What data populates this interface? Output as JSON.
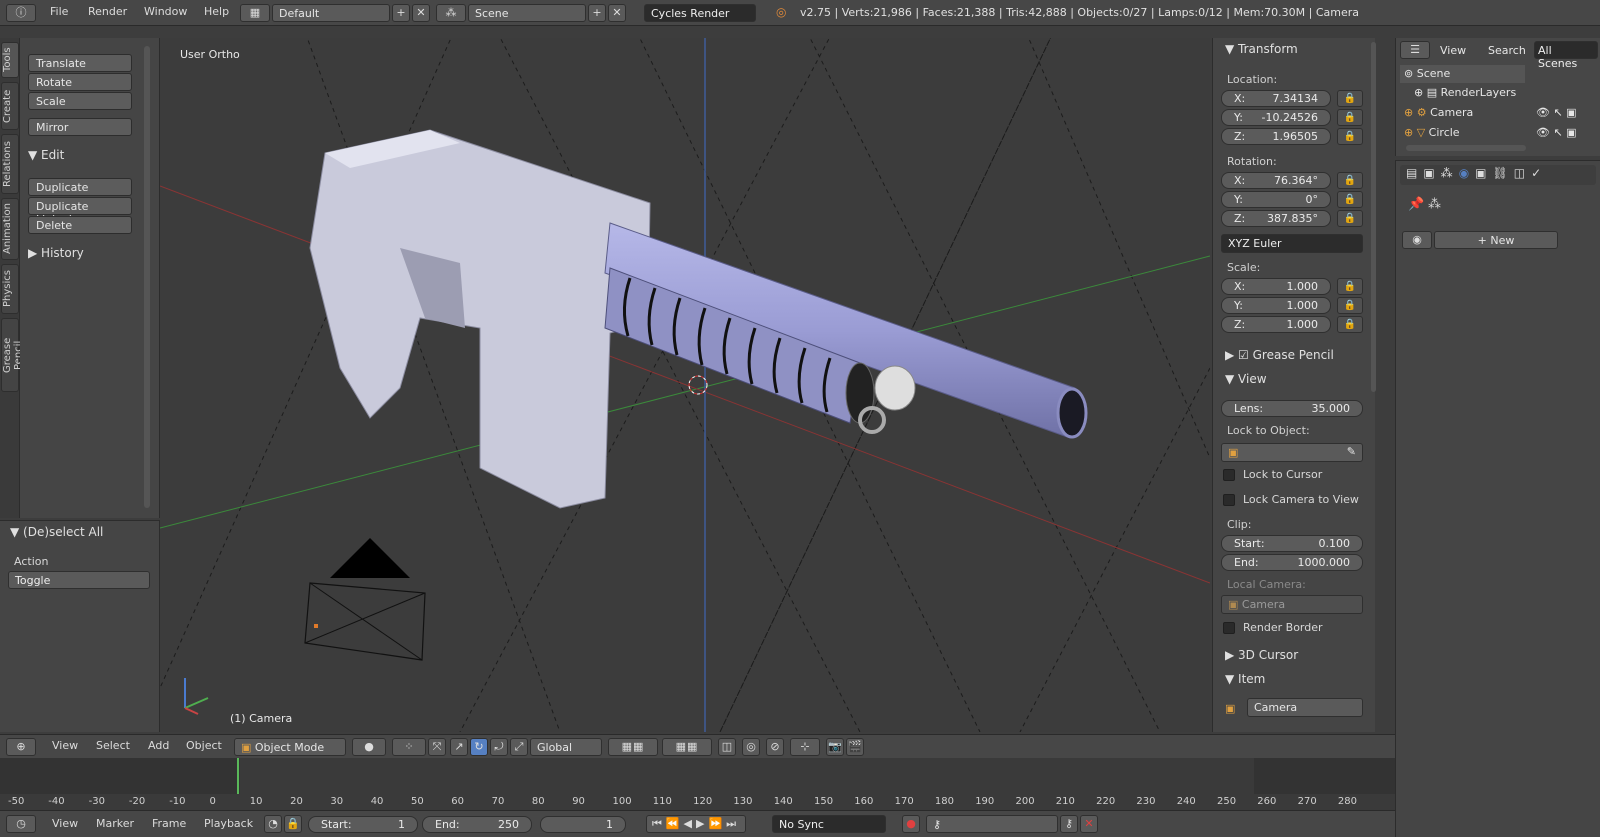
{
  "header": {
    "menus": [
      "File",
      "Render",
      "Window",
      "Help"
    ],
    "layout": "Default",
    "scene": "Scene",
    "engine": "Cycles Render",
    "stats": "v2.75 | Verts:21,986 | Faces:21,388 | Tris:42,888 | Objects:0/27 | Lamps:0/12 | Mem:70.30M | Camera"
  },
  "tool_tabs": [
    "Tools",
    "Create",
    "Relations",
    "Animation",
    "Physics",
    "Grease Pencil"
  ],
  "tool_shelf": {
    "transform_buttons": [
      "Translate",
      "Rotate",
      "Scale"
    ],
    "mirror": "Mirror",
    "edit_header": "Edit",
    "edit_buttons": [
      "Duplicate",
      "Duplicate Linked",
      "Delete"
    ],
    "history_header": "History"
  },
  "operator_panel": {
    "title": "(De)select All",
    "action_label": "Action",
    "action_value": "Toggle"
  },
  "viewport": {
    "view_label": "User Ortho",
    "object_label": "(1) Camera"
  },
  "npanel": {
    "transform_title": "Transform",
    "location_label": "Location:",
    "location": [
      {
        "axis": "X:",
        "value": "7.34134"
      },
      {
        "axis": "Y:",
        "value": "-10.24526"
      },
      {
        "axis": "Z:",
        "value": "1.96505"
      }
    ],
    "rotation_label": "Rotation:",
    "rotation": [
      {
        "axis": "X:",
        "value": "76.364°"
      },
      {
        "axis": "Y:",
        "value": "0°"
      },
      {
        "axis": "Z:",
        "value": "387.835°"
      }
    ],
    "rotation_mode": "XYZ Euler",
    "scale_label": "Scale:",
    "scale": [
      {
        "axis": "X:",
        "value": "1.000"
      },
      {
        "axis": "Y:",
        "value": "1.000"
      },
      {
        "axis": "Z:",
        "value": "1.000"
      }
    ],
    "grease_pencil": "Grease Pencil",
    "view_title": "View",
    "lens_label": "Lens:",
    "lens_value": "35.000",
    "lock_to_object": "Lock to Object:",
    "lock_to_cursor": "Lock to Cursor",
    "lock_camera": "Lock Camera to View",
    "clip_label": "Clip:",
    "clip_start_label": "Start:",
    "clip_start": "0.100",
    "clip_end_label": "End:",
    "clip_end": "1000.000",
    "local_camera": "Local Camera:",
    "local_camera_value": "Camera",
    "render_border": "Render Border",
    "cursor_title": "3D Cursor",
    "item_title": "Item",
    "item_name": "Camera"
  },
  "outliner": {
    "tabs": [
      "View",
      "Search",
      "All Scenes"
    ],
    "items": [
      "Scene",
      "RenderLayers",
      "Camera",
      "Circle"
    ]
  },
  "props_editor": {
    "new_label": "New"
  },
  "viewport_header": {
    "menus": [
      "View",
      "Select",
      "Add",
      "Object"
    ],
    "mode": "Object Mode",
    "orientation": "Global"
  },
  "timeline": {
    "ticks": [
      "-50",
      "-40",
      "-30",
      "-20",
      "-10",
      "0",
      "10",
      "20",
      "30",
      "40",
      "50",
      "60",
      "70",
      "80",
      "90",
      "100",
      "110",
      "120",
      "130",
      "140",
      "150",
      "160",
      "170",
      "180",
      "190",
      "200",
      "210",
      "220",
      "230",
      "240",
      "250",
      "260",
      "270",
      "280"
    ],
    "current_frame": "1"
  },
  "timeline_header": {
    "menus": [
      "View",
      "Marker",
      "Frame",
      "Playback"
    ],
    "start_label": "Start:",
    "start": "1",
    "end_label": "End:",
    "end": "250",
    "frame": "1",
    "sync": "No Sync"
  },
  "colors": {
    "accent": "#5680c2",
    "active_frame": "#5ab85a",
    "gun_body": "#cfd0dc"
  }
}
